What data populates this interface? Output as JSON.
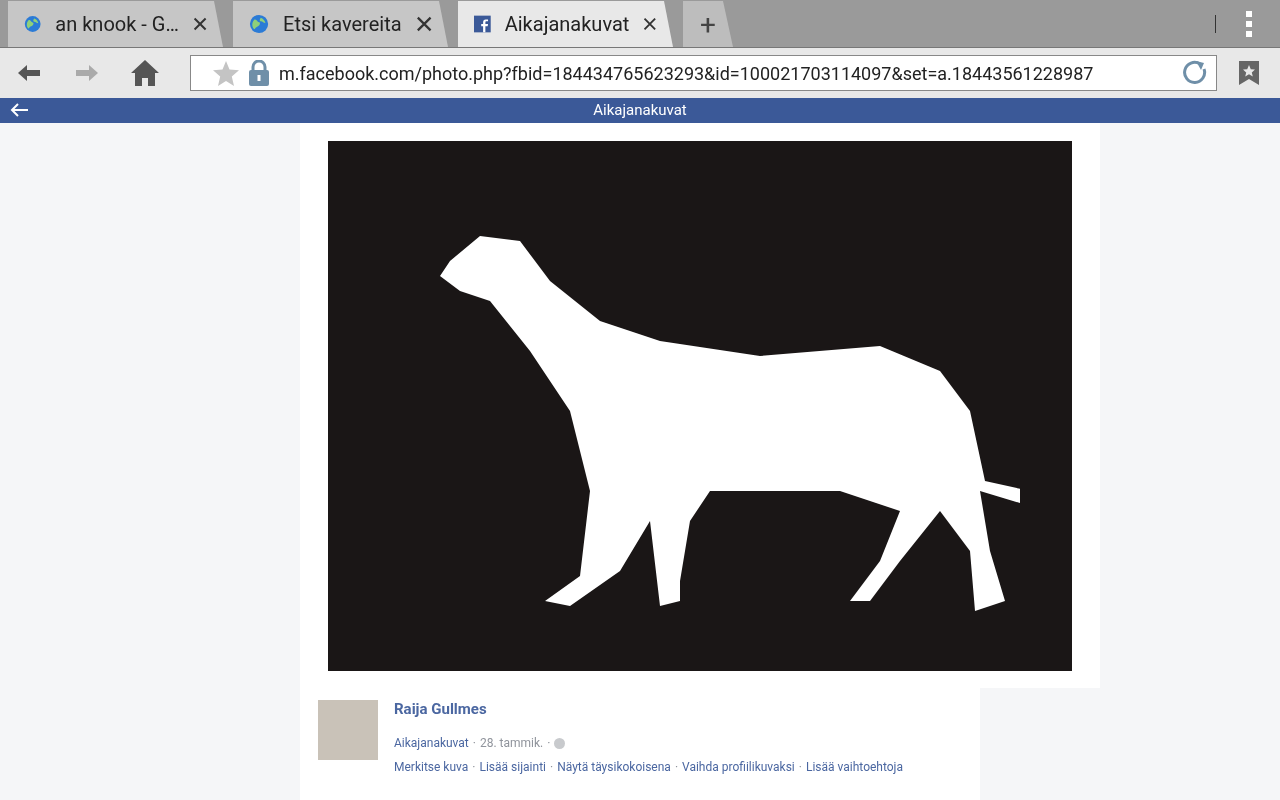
{
  "tabs": [
    {
      "label": "an knook - G…",
      "kind": "web",
      "selected": false
    },
    {
      "label": "Etsi kavereita",
      "kind": "web",
      "selected": false
    },
    {
      "label": "Aikajanakuvat",
      "kind": "facebook",
      "selected": true
    }
  ],
  "new_tab": "+",
  "address_bar": {
    "url": "m.facebook.com/photo.php?fbid=184434765623293&id=100021703114097&set=a.18443561228987",
    "secure": true
  },
  "header": {
    "title": "Aikajanakuvat"
  },
  "post": {
    "author": "Raija Gullmes",
    "album": "Aikajanakuvat",
    "date": "28. tammik.",
    "separator": "·",
    "actions": [
      "Merkitse kuva",
      "Lisää sijainti",
      "Näytä täysikokoisena",
      "Vaihda profiilikuvaksi",
      "Lisää vaihtoehtoja"
    ]
  }
}
